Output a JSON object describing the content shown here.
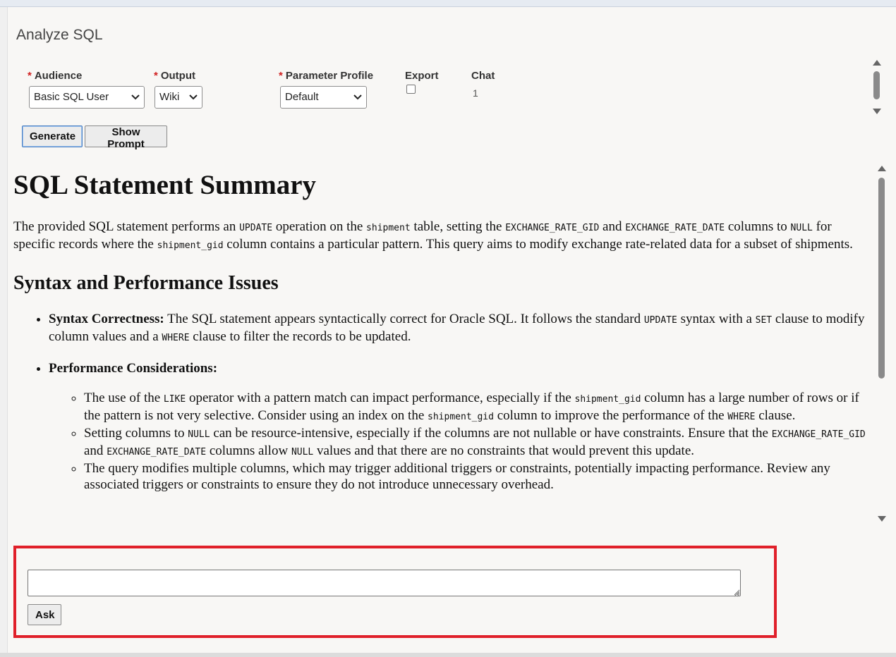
{
  "panel": {
    "title": "Analyze SQL"
  },
  "form": {
    "audience": {
      "label": "Audience",
      "value": "Basic SQL User"
    },
    "output": {
      "label": "Output",
      "value": "Wiki"
    },
    "parameter_profile": {
      "label": "Parameter Profile",
      "value": "Default"
    },
    "export": {
      "label": "Export",
      "checked": false
    },
    "chat": {
      "label": "Chat",
      "value": "1"
    },
    "required_mark": "*"
  },
  "buttons": {
    "generate": "Generate",
    "show_prompt": "Show Prompt",
    "ask": "Ask"
  },
  "report": {
    "title": "SQL Statement Summary",
    "summary": {
      "t1": "The provided SQL statement performs an ",
      "c1": "UPDATE",
      "t2": " operation on the ",
      "c2": "shipment",
      "t3": " table, setting the ",
      "c3": "EXCHANGE_RATE_GID",
      "t4": " and ",
      "c4": "EXCHANGE_RATE_DATE",
      "t5": " columns to ",
      "c5": "NULL",
      "t6": " for specific records where the ",
      "c6": "shipment_gid",
      "t7": " column contains a particular pattern. This query aims to modify exchange rate-related data for a subset of shipments."
    },
    "section_heading": "Syntax and Performance Issues",
    "syntax": {
      "label": "Syntax Correctness:",
      "t1": " The SQL statement appears syntactically correct for Oracle SQL. It follows the standard ",
      "c1": "UPDATE",
      "t2": " syntax with a ",
      "c2": "SET",
      "t3": " clause to modify column values and a ",
      "c3": "WHERE",
      "t4": " clause to filter the records to be updated."
    },
    "performance": {
      "label": "Performance Considerations:",
      "item1": {
        "t1": "The use of the ",
        "c1": "LIKE",
        "t2": " operator with a pattern match can impact performance, especially if the ",
        "c2": "shipment_gid",
        "t3": " column has a large number of rows or if the pattern is not very selective. Consider using an index on the ",
        "c3": "shipment_gid",
        "t4": " column to improve the performance of the ",
        "c4": "WHERE",
        "t5": " clause."
      },
      "item2": {
        "t1": "Setting columns to ",
        "c1": "NULL",
        "t2": " can be resource-intensive, especially if the columns are not nullable or have constraints. Ensure that the ",
        "c2": "EXCHANGE_RATE_GID",
        "t3": " and ",
        "c3": "EXCHANGE_RATE_DATE",
        "t4": " columns allow ",
        "c4": "NULL",
        "t5": " values and that there are no constraints that would prevent this update."
      },
      "item3": {
        "t1": "The query modifies multiple columns, which may trigger additional triggers or constraints, potentially impacting performance. Review any associated triggers or constraints to ensure they do not introduce unnecessary overhead."
      }
    }
  },
  "chat_input": {
    "value": "",
    "placeholder": ""
  },
  "icons": {
    "select_chevron": "chevron-down-icon",
    "scroll_up": "scroll-up-arrow-icon",
    "scroll_down": "scroll-down-arrow-icon",
    "resize": "resize-grip-icon"
  },
  "colors": {
    "highlight_border": "#e0202a",
    "required": "#d02020",
    "primary_button_border": "#4a7fc1"
  }
}
